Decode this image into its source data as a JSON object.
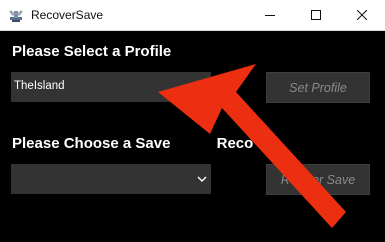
{
  "window": {
    "title": "RecoverSave",
    "icon": "tool-icon",
    "controls": [
      "minimize-icon",
      "maximize-icon",
      "close-icon"
    ]
  },
  "profile_section": {
    "heading": "Please Select a Profile",
    "selected_profile": "TheIsland",
    "set_button_label": "Set Profile"
  },
  "save_section": {
    "heading_before": "Please Choose a Save",
    "heading_after": "Reco",
    "selected_save": "",
    "recover_label_before": "R",
    "recover_label_after": "over Save"
  },
  "overlay": {
    "arrow_icon": "red-arrow-icon",
    "arrow_color": "#ec2f10"
  },
  "colors": {
    "background": "#000000",
    "control_bg": "#333333",
    "disabled_text": "#8a8a8a"
  }
}
